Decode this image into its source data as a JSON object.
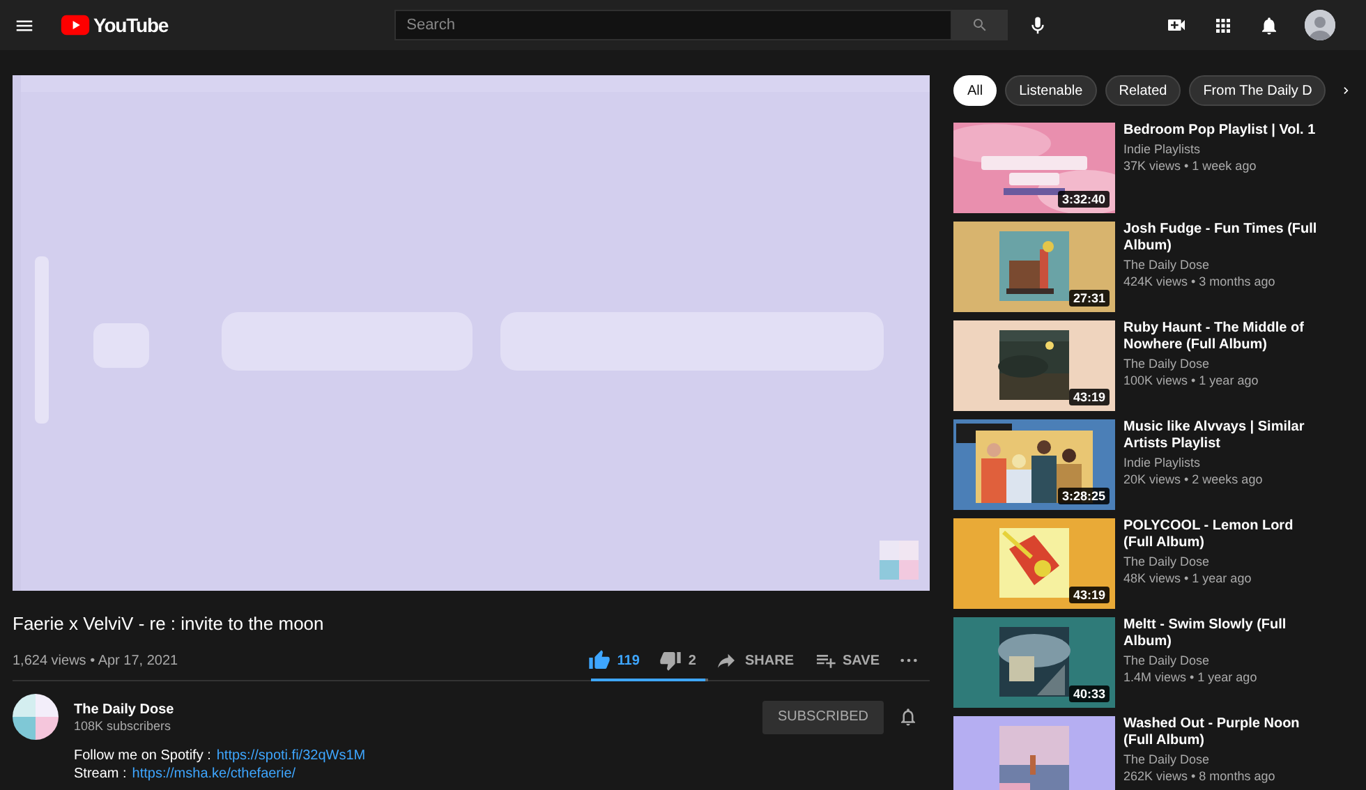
{
  "header": {
    "logo": "YouTube",
    "search": {
      "placeholder": "Search"
    }
  },
  "video": {
    "title": "Faerie x VelviV - re : invite to the moon",
    "meta": "1,624 views • Apr 17, 2021",
    "likes": "119",
    "dislikes": "2",
    "liked": true,
    "sentiment": {
      "level": 0.98
    },
    "share": "SHARE",
    "save": "SAVE"
  },
  "channel": {
    "name": "The Daily Dose",
    "subscribers": "108K subscribers",
    "button": "SUBSCRIBED",
    "subscribed": true
  },
  "description": [
    {
      "label": "Follow me on Spotify :",
      "link": "https://spoti.fi/32qWs1M"
    },
    {
      "label": "Stream :",
      "link": "https://msha.ke/cthefaerie/"
    }
  ],
  "chips": [
    {
      "label": "All",
      "selected": true
    },
    {
      "label": "Listenable",
      "selected": false
    },
    {
      "label": "Related",
      "selected": false
    },
    {
      "label": "From The Daily D",
      "selected": false
    }
  ],
  "recommendations": [
    {
      "title": "Bedroom Pop Playlist | Vol. 1",
      "channel": "Indie Playlists",
      "meta": "37K views • 1 week ago",
      "duration": "3:32:40"
    },
    {
      "title": "Josh Fudge - Fun Times (Full Album)",
      "channel": "The Daily Dose",
      "meta": "424K views • 3 months ago",
      "duration": "27:31"
    },
    {
      "title": "Ruby Haunt - The Middle of Nowhere (Full Album)",
      "channel": "The Daily Dose",
      "meta": "100K views • 1 year ago",
      "duration": "43:19"
    },
    {
      "title": "Music like Alvvays | Similar Artists Playlist",
      "channel": "Indie Playlists",
      "meta": "20K views • 2 weeks ago",
      "duration": "3:28:25"
    },
    {
      "title": "POLYCOOL - Lemon Lord (Full Album)",
      "channel": "The Daily Dose",
      "meta": "48K views • 1 year ago",
      "duration": "43:19"
    },
    {
      "title": "Meltt - Swim Slowly (Full Album)",
      "channel": "The Daily Dose",
      "meta": "1.4M views • 1 year ago",
      "duration": "40:33"
    },
    {
      "title": "Washed Out - Purple Noon (Full Album)",
      "channel": "The Daily Dose",
      "meta": "262K views • 8 months ago"
    }
  ]
}
